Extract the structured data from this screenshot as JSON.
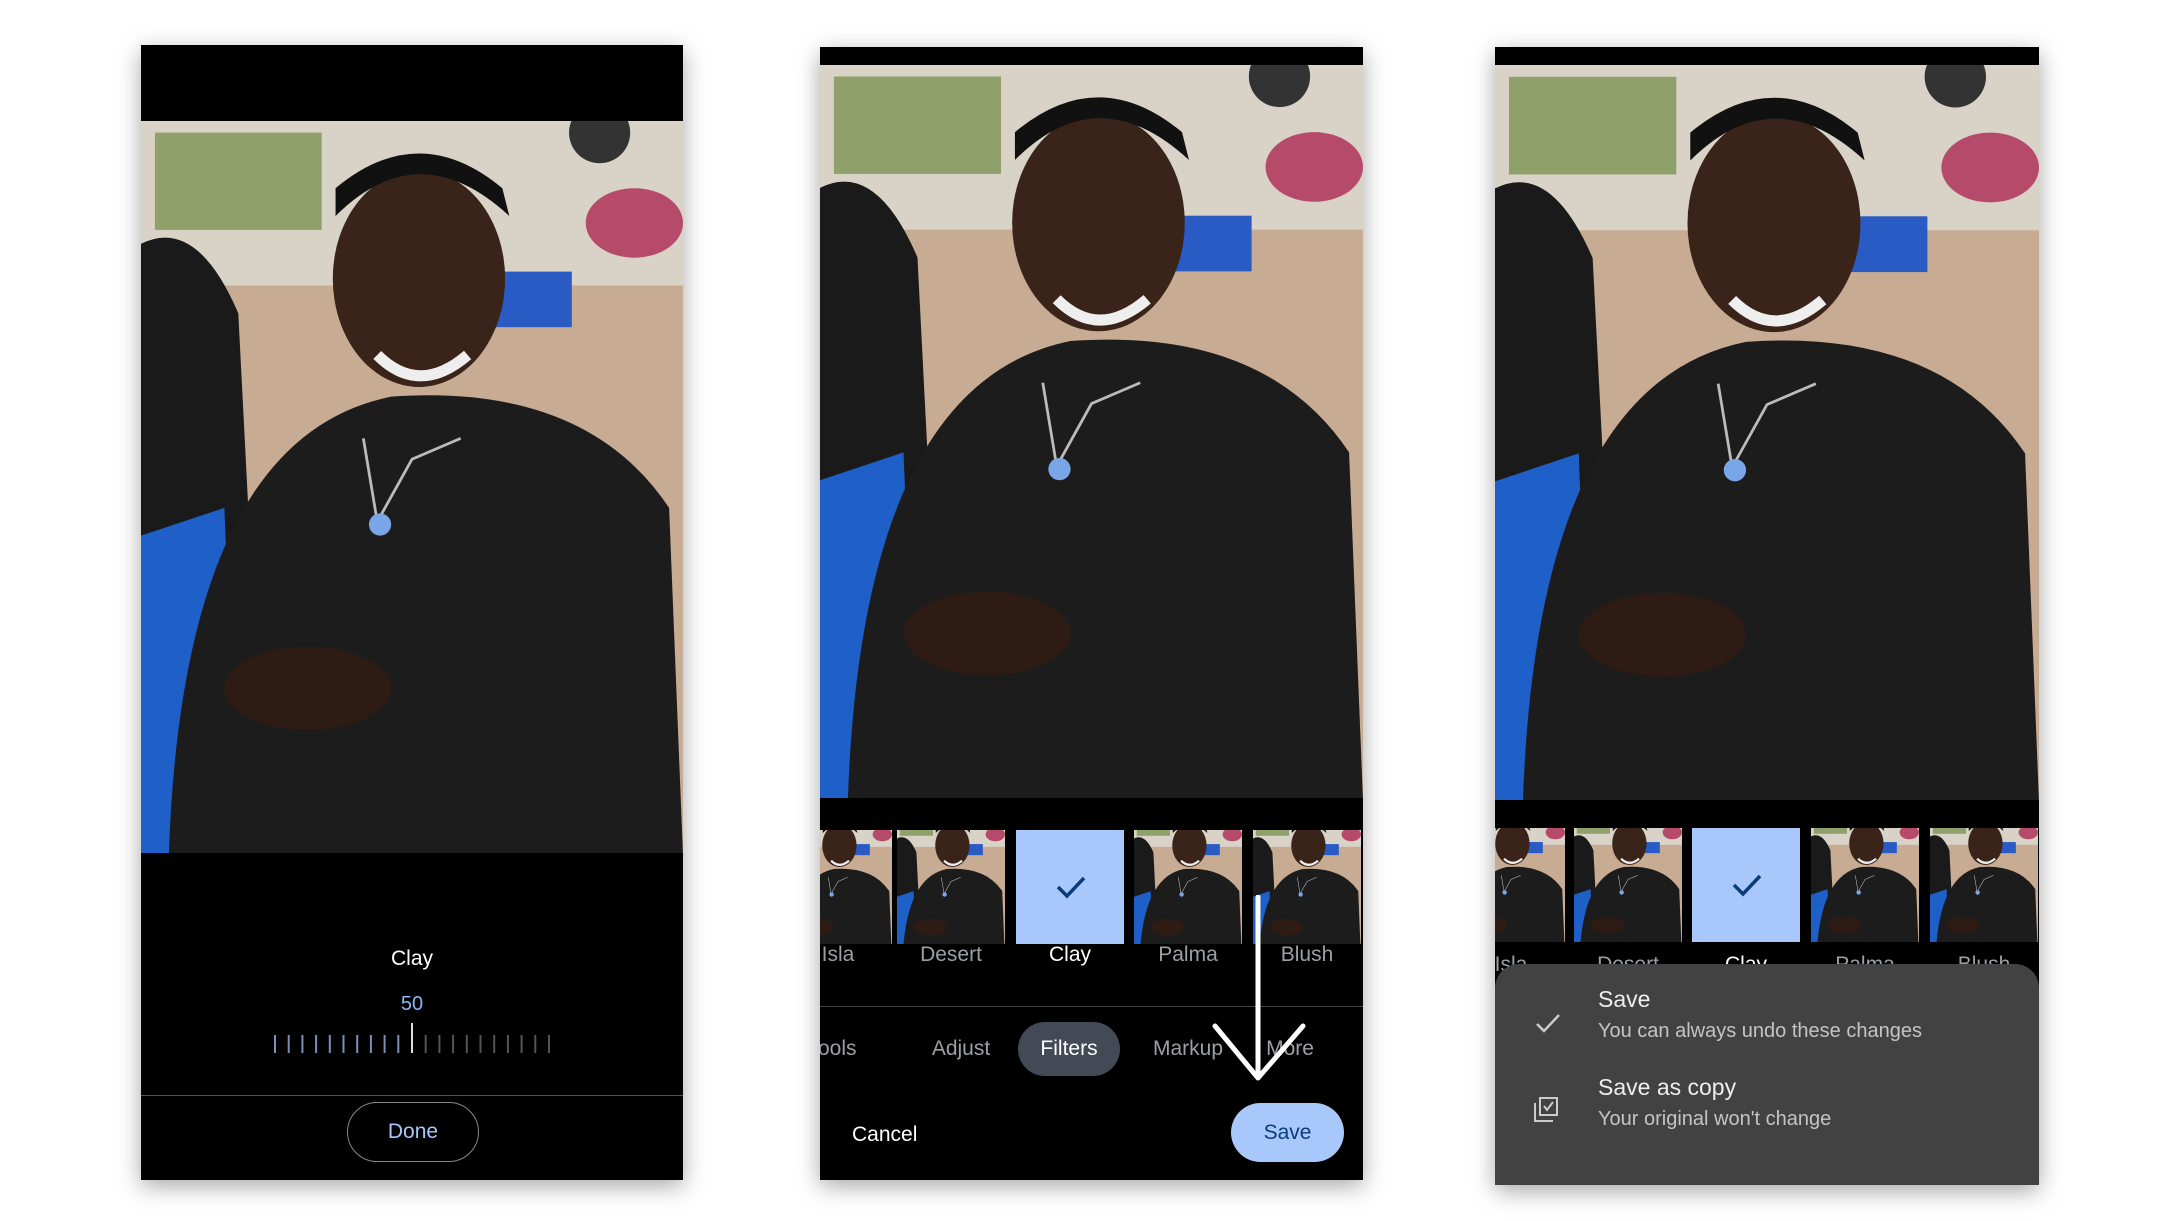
{
  "panel1": {
    "filter_name": "Clay",
    "intensity_value": "50",
    "intensity_percent": 50,
    "done_label": "Done"
  },
  "panel2": {
    "filters": [
      {
        "label": "Isla"
      },
      {
        "label": "Desert"
      },
      {
        "label": "Clay",
        "selected": true
      },
      {
        "label": "Palma"
      },
      {
        "label": "Blush"
      }
    ],
    "tabs": [
      "Tools",
      "Adjust",
      "Filters",
      "Markup",
      "More"
    ],
    "active_tab": "Filters",
    "cancel_label": "Cancel",
    "save_label": "Save"
  },
  "panel3": {
    "filters": [
      {
        "label": "Isla"
      },
      {
        "label": "Desert"
      },
      {
        "label": "Clay",
        "selected": true
      },
      {
        "label": "Palma"
      },
      {
        "label": "Blush"
      }
    ],
    "save_menu": [
      {
        "icon": "check-icon",
        "title": "Save",
        "subtitle": "You can always undo these changes"
      },
      {
        "icon": "save-copy-icon",
        "title": "Save as copy",
        "subtitle": "Your original won't change"
      }
    ]
  },
  "colors": {
    "accent": "#a8c7fa",
    "accent_text": "#0b3c7a",
    "sheet": "#424242",
    "pill": "#444a55"
  }
}
